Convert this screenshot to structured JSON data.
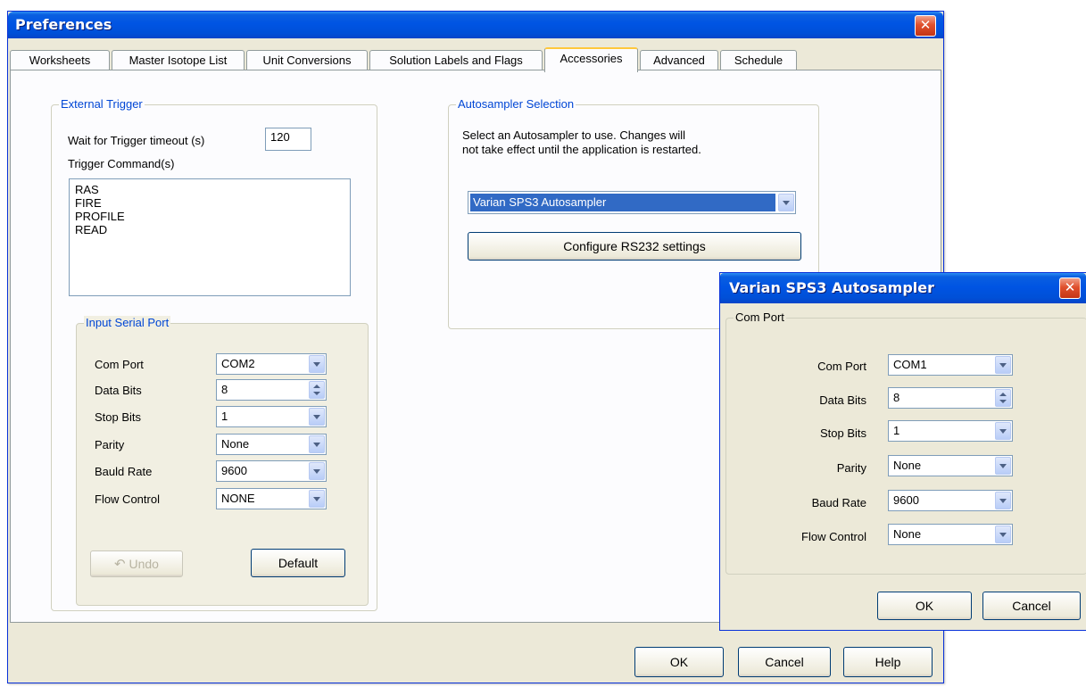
{
  "window": {
    "title": "Preferences"
  },
  "tabs": [
    {
      "label": "Worksheets",
      "active": false
    },
    {
      "label": "Master Isotope List",
      "active": false
    },
    {
      "label": "Unit Conversions",
      "active": false
    },
    {
      "label": "Solution Labels and Flags",
      "active": false
    },
    {
      "label": "Accessories",
      "active": true
    },
    {
      "label": "Advanced",
      "active": false
    },
    {
      "label": "Schedule",
      "active": false
    }
  ],
  "external_trigger": {
    "legend": "External Trigger",
    "timeout_label": "Wait for Trigger timeout (s)",
    "timeout_value": "120",
    "commands_label": "Trigger Command(s)",
    "commands": [
      "RAS",
      "FIRE",
      "PROFILE",
      "READ"
    ]
  },
  "input_serial_port": {
    "legend": "Input Serial Port",
    "com_port": {
      "label": "Com Port",
      "value": "COM2"
    },
    "data_bits": {
      "label": "Data Bits",
      "value": "8"
    },
    "stop_bits": {
      "label": "Stop Bits",
      "value": "1"
    },
    "parity": {
      "label": "Parity",
      "value": "None"
    },
    "baud_rate": {
      "label": "Bauld Rate",
      "value": "9600"
    },
    "flow_control": {
      "label": "Flow Control",
      "value": "NONE"
    },
    "undo_label": "Undo",
    "default_label": "Default"
  },
  "autosampler": {
    "legend": "Autosampler Selection",
    "description_line1": "Select an Autosampler to use.  Changes will",
    "description_line2": "not take effect until the application is restarted.",
    "selected": "Varian SPS3 Autosampler",
    "configure_label": "Configure RS232 settings"
  },
  "footer": {
    "ok": "OK",
    "cancel": "Cancel",
    "help": "Help"
  },
  "dialog": {
    "title": "Varian SPS3 Autosampler",
    "group_label": "Com Port",
    "com_port": {
      "label": "Com Port",
      "value": "COM1"
    },
    "data_bits": {
      "label": "Data Bits",
      "value": "8"
    },
    "stop_bits": {
      "label": "Stop Bits",
      "value": "1"
    },
    "parity": {
      "label": "Parity",
      "value": "None"
    },
    "baud_rate": {
      "label": "Baud Rate",
      "value": "9600"
    },
    "flow_control": {
      "label": "Flow Control",
      "value": "None"
    },
    "ok": "OK",
    "cancel": "Cancel"
  },
  "colors": {
    "titlebar": "#0054e3",
    "window_bg": "#ece9d8",
    "selection": "#316ac5",
    "legend_text": "#0046d5"
  }
}
